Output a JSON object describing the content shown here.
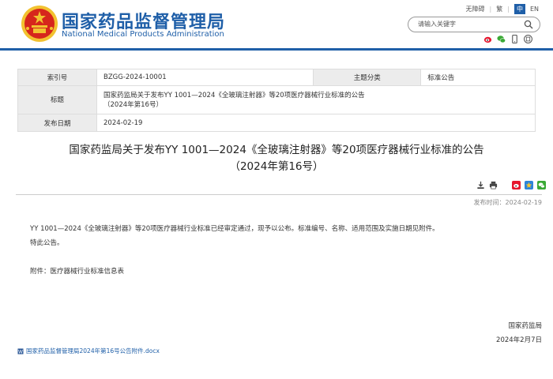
{
  "header": {
    "title_cn": "国家药品监督管理局",
    "title_en": "National Medical Products Administration",
    "links": {
      "accessibility": "无障碍",
      "traditional": "繁",
      "chinese": "中",
      "english": "EN"
    },
    "search_placeholder": "请输入关键字",
    "social_icons": [
      "weibo-icon",
      "wechat-icon",
      "mobile-icon",
      "app-icon"
    ],
    "colors": {
      "brand": "#1f5fa8",
      "emblem_red": "#d6261c",
      "emblem_gold": "#f2c230"
    }
  },
  "meta": {
    "index_label": "索引号",
    "index_value": "BZGG-2024-10001",
    "category_label": "主题分类",
    "category_value": "标准公告",
    "title_label": "标题",
    "title_value_line1": "国家药监局关于发布YY 1001—2024《全玻璃注射器》等20项医疗器械行业标准的公告",
    "title_value_line2": "（2024年第16号）",
    "date_label": "发布日期",
    "date_value": "2024-02-19"
  },
  "article": {
    "title_line1": "国家药监局关于发布YY 1001—2024《全玻璃注射器》等20项医疗器械行业标准的公告",
    "title_line2": "（2024年第16号）",
    "publish_time": "发布时间：2024-02-19",
    "paragraph1": "YY 1001—2024《全玻璃注射器》等20项医疗器械行业标准已经审定通过，现予以公布。标准编号、名称、适用范围及实施日期见附件。",
    "paragraph2": "特此公告。",
    "attachment_note": "附件：医疗器械行业标准信息表",
    "signature": "国家药监局",
    "sign_date": "2024年2月7日",
    "attachment_file": "国家药品监督管理局2024年第16号公告附件.docx",
    "tool_icons": [
      "download-icon",
      "print-icon",
      "weibo-icon",
      "favorite-icon",
      "wechat-icon"
    ]
  }
}
